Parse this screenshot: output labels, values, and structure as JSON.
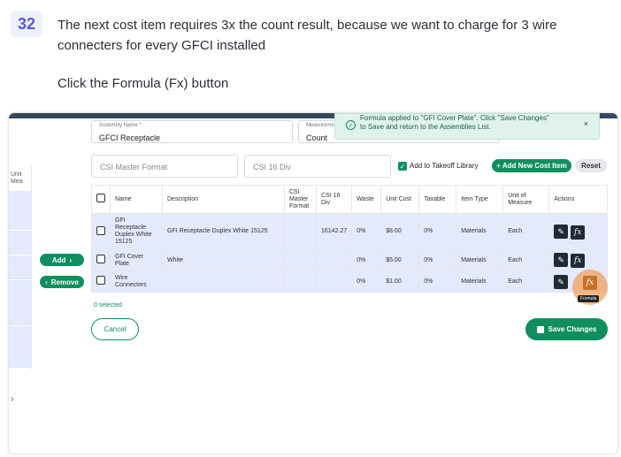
{
  "tutorial": {
    "step_number": "32",
    "instruction": "The next cost item requires 3x the count result, because we want to charge for 3 wire connecters for every GFCI installed",
    "action": "Click the Formula (Fx) button"
  },
  "form": {
    "assembly_name_label": "Assembly Name *",
    "assembly_name_value": "GFCI Receptacle",
    "measurement_label": "Measurement",
    "measurement_value": "Count",
    "csi_master_placeholder": "CSI Master Format",
    "csi_16_placeholder": "CSI 16 Div",
    "add_to_takeoff_label": "Add to Takeoff Library",
    "add_new_cost_item_label": "+ Add New Cost Item",
    "reset_label": "Reset"
  },
  "toast": {
    "message_line1": "Formula applied to \"GFI Cover Plate\". Click \"Save Changes\"",
    "message_line2": "to Save and return to the Assemblies List.",
    "close_symbol": "×"
  },
  "side": {
    "add_label": "Add",
    "remove_label": "Remove",
    "left_header": "Unit Mea"
  },
  "table": {
    "headers": [
      "Name",
      "Description",
      "CSI Master Format",
      "CSI 16 Div",
      "Waste",
      "Unit Cost",
      "Taxable",
      "Item Type",
      "Unit of Measure",
      "Actions"
    ],
    "rows": [
      {
        "name": "GFI Receptacle Duplex White 15125",
        "description": "GFI Receptacle Duplex White 15125",
        "csi_master": "",
        "csi16": "16142.27",
        "waste": "0%",
        "unit_cost": "$8.00",
        "taxable": "0%",
        "item_type": "Materials",
        "uom": "Each"
      },
      {
        "name": "GFI Cover Plate",
        "description": "White",
        "csi_master": "",
        "csi16": "",
        "waste": "0%",
        "unit_cost": "$5.00",
        "taxable": "0%",
        "item_type": "Materials",
        "uom": "Each"
      },
      {
        "name": "Wire Connecters",
        "description": "",
        "csi_master": "",
        "csi16": "",
        "waste": "0%",
        "unit_cost": "$1.00",
        "taxable": "0%",
        "item_type": "Materials",
        "uom": "Each"
      }
    ]
  },
  "footer": {
    "selected_text": "0 selected",
    "cancel_label": "Cancel",
    "save_label": "Save Changes",
    "tooltip_text": "Formula"
  },
  "icons": {
    "edit": "pencil-icon",
    "formula": "fx-icon",
    "save": "floppy-icon",
    "success": "check-circle-icon"
  },
  "colors": {
    "accent": "#0f8f5f",
    "row_bg": "#e4e9fb",
    "highlight": "#f0964680",
    "badge": "#5b57d6"
  }
}
